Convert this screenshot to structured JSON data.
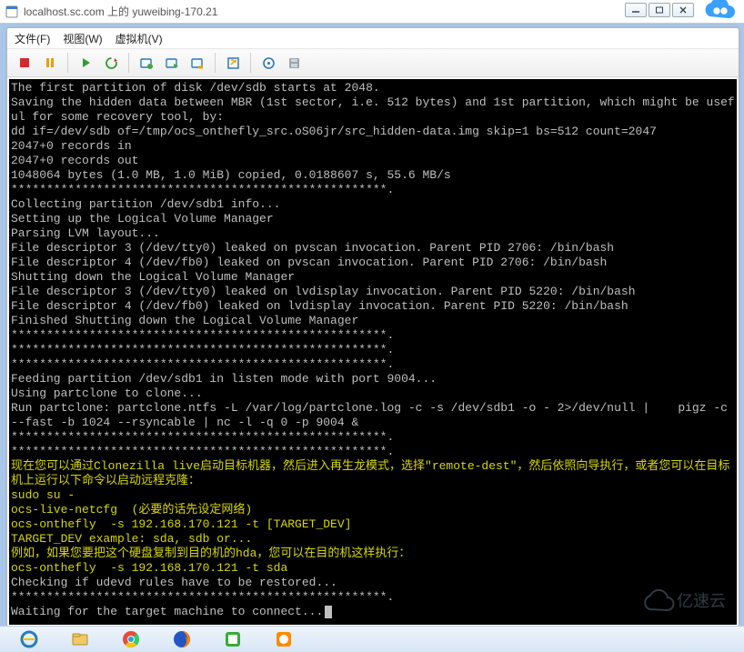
{
  "chrome": {
    "title": "localhost.sc.com 上的 yuweibing-170.21"
  },
  "vm": {
    "menubar": {
      "file": "文件(F)",
      "view": "视图(W)",
      "vm": "虚拟机(V)"
    }
  },
  "terminal": {
    "lines": [
      {
        "t": "The first partition of disk /dev/sdb starts at 2048."
      },
      {
        "t": "Saving the hidden data between MBR (1st sector, i.e. 512 bytes) and 1st partition, which might be useful for some recovery tool, by:"
      },
      {
        "t": "dd if=/dev/sdb of=/tmp/ocs_onthefly_src.oS06jr/src_hidden-data.img skip=1 bs=512 count=2047"
      },
      {
        "t": "2047+0 records in"
      },
      {
        "t": "2047+0 records out"
      },
      {
        "t": "1048064 bytes (1.0 MB, 1.0 MiB) copied, 0.0188607 s, 55.6 MB/s"
      },
      {
        "t": "*****************************************************."
      },
      {
        "t": "Collecting partition /dev/sdb1 info..."
      },
      {
        "t": "Setting up the Logical Volume Manager"
      },
      {
        "t": "Parsing LVM layout..."
      },
      {
        "t": "File descriptor 3 (/dev/tty0) leaked on pvscan invocation. Parent PID 2706: /bin/bash"
      },
      {
        "t": "File descriptor 4 (/dev/fb0) leaked on pvscan invocation. Parent PID 2706: /bin/bash"
      },
      {
        "t": "Shutting down the Logical Volume Manager"
      },
      {
        "t": "File descriptor 3 (/dev/tty0) leaked on lvdisplay invocation. Parent PID 5220: /bin/bash"
      },
      {
        "t": "File descriptor 4 (/dev/fb0) leaked on lvdisplay invocation. Parent PID 5220: /bin/bash"
      },
      {
        "t": "Finished Shutting down the Logical Volume Manager"
      },
      {
        "t": "*****************************************************."
      },
      {
        "t": "*****************************************************."
      },
      {
        "t": "*****************************************************."
      },
      {
        "t": "Feeding partition /dev/sdb1 in listen mode with port 9004..."
      },
      {
        "t": "Using partclone to clone..."
      },
      {
        "t": "Run partclone: partclone.ntfs -L /var/log/partclone.log -c -s /dev/sdb1 -o - 2>/dev/null |    pigz -c --fast -b 1024 --rsyncable | nc -l -q 0 -p 9004 &"
      },
      {
        "t": "*****************************************************."
      },
      {
        "t": "*****************************************************."
      },
      {
        "t": "现在您可以通过Clonezilla live启动目标机器，然后进入再生龙模式，选择\"remote-dest\"，然后依照向导执行，或者您可以在目标机上运行以下命令以启动远程克隆：",
        "c": "yel"
      },
      {
        "t": "sudo su -",
        "c": "yel"
      },
      {
        "t": "ocs-live-netcfg  (必要的话先设定网络)",
        "c": "yel"
      },
      {
        "t": "ocs-onthefly  -s 192.168.170.121 -t [TARGET_DEV]",
        "c": "yel"
      },
      {
        "t": "TARGET_DEV example: sda, sdb or...",
        "c": "yel"
      },
      {
        "t": "例如，如果您要把这个硬盘复制到目的机的hda，您可以在目的机这样执行：",
        "c": "yel"
      },
      {
        "t": "ocs-onthefly  -s 192.168.170.121 -t sda",
        "c": "yel"
      },
      {
        "t": "Checking if udevd rules have to be restored..."
      },
      {
        "t": "*****************************************************."
      },
      {
        "t": "Waiting for the target machine to connect...",
        "cursor": true
      }
    ]
  },
  "watermark_text": "亿速云"
}
